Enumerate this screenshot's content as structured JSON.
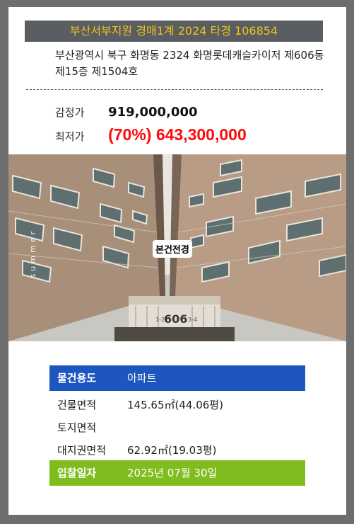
{
  "header": {
    "court_case": "부산서부지원 경매1계 2024 타경 106854"
  },
  "address": "부산광역시 북구 화명동 2324 화명롯데캐슬카이저 제606동 제15층 제1504호",
  "prices": {
    "appraised_label": "감정가",
    "appraised_value": "919,000,000",
    "minimum_label": "최저가",
    "minimum_value": "(70%) 643,300,000"
  },
  "photo": {
    "badge": "본건전경",
    "watermark": "summer",
    "building_sign": "606",
    "sign_left": "1-2",
    "sign_right": "3-4"
  },
  "details": {
    "usage_label": "물건용도",
    "usage_value": "아파트",
    "building_area_label": "건물면적",
    "building_area_value": "145.65㎡(44.06평)",
    "land_area_label": "토지면적",
    "land_area_value": "",
    "land_right_label": "대지권면적",
    "land_right_value": "62.92㎡(19.03평)",
    "bid_date_label": "입찰일자",
    "bid_date_value": "2025년 07월 30일"
  },
  "colors": {
    "banner_bg": "#5a5d61",
    "banner_text": "#f0c419",
    "minimum_price": "#ff0a0a",
    "usage_row": "#1e56c0",
    "bid_row": "#7fbd1f"
  }
}
